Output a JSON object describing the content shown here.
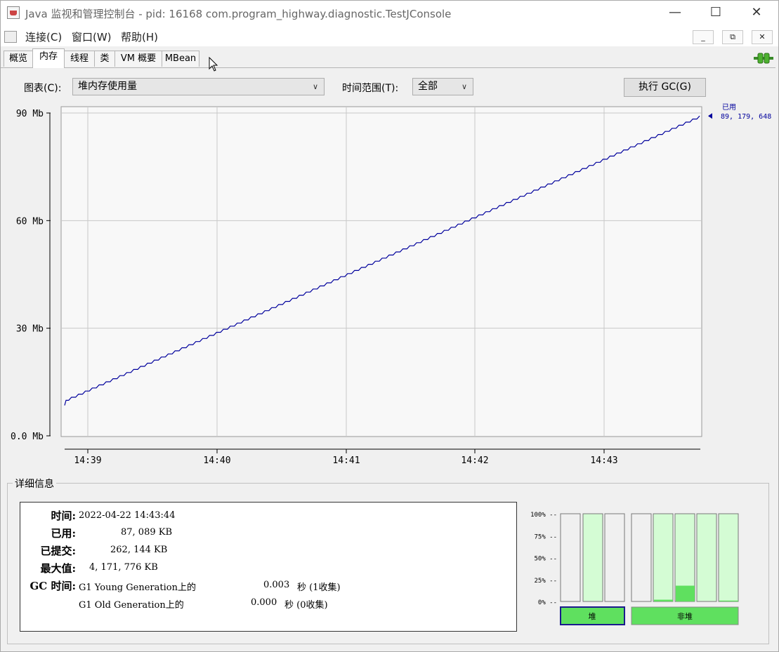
{
  "window": {
    "title": "Java 监视和管理控制台 - pid: 16168 com.program_highway.diagnostic.TestJConsole",
    "min_icon": "minimize-icon",
    "max_icon": "maximize-icon",
    "close_icon": "close-icon"
  },
  "menu": {
    "items": [
      "连接(C)",
      "窗口(W)",
      "帮助(H)"
    ],
    "mdi_buttons": [
      "_",
      "⧉",
      "✕"
    ]
  },
  "tabs": {
    "items": [
      "概览",
      "内存",
      "线程",
      "类",
      "VM 概要",
      "MBean"
    ],
    "active": "内存"
  },
  "controls": {
    "chart_label": "图表(C):",
    "chart_value": "堆内存使用量",
    "range_label": "时间范围(T):",
    "range_value": "全部",
    "gc_button": "执行 GC(G)"
  },
  "chart_data": {
    "type": "line",
    "y_ticks": [
      "90 Mb",
      "60 Mb",
      "30 Mb",
      "0.0 Mb"
    ],
    "y_tick_values": [
      90,
      60,
      30,
      0
    ],
    "x_ticks": [
      "14:39",
      "14:40",
      "14:41",
      "14:42",
      "14:43"
    ],
    "ylim": [
      0,
      90
    ],
    "series": [
      {
        "name": "已用",
        "color": "#00009c",
        "start_value_mb": 8.5,
        "end_value_mb": 89.18,
        "shape": "staircase-linear"
      }
    ],
    "legend": {
      "label": "已用",
      "value": "89, 179, 648"
    },
    "grid": true,
    "background": "#f8f8f8"
  },
  "details": {
    "title": "详细信息",
    "rows": [
      {
        "label": "时间:",
        "value": "2022-04-22 14:43:44"
      },
      {
        "label": "已用:",
        "value": "87, 089 KB"
      },
      {
        "label": "已提交:",
        "value": "262, 144 KB"
      },
      {
        "label": "最大值:",
        "value": "4, 171, 776 KB"
      }
    ],
    "gc_label": "GC 时间:",
    "gc_rows": [
      {
        "name": "G1 Young Generation上的",
        "time": "0.003",
        "unit": "秒 (1收集)"
      },
      {
        "name": "G1 Old Generation上的",
        "time": "0.000",
        "unit": "秒 (0收集)"
      }
    ]
  },
  "pools": {
    "y_labels": [
      "100% --",
      "75% --",
      "50% --",
      "25% --",
      "0% --"
    ],
    "heap_label": "堆",
    "nonheap_label": "非堆",
    "heap_bars": [
      {
        "capacity_pct": 100,
        "used_pct": 0,
        "filled_bg": false
      },
      {
        "capacity_pct": 100,
        "used_pct": 0,
        "filled_bg": true
      },
      {
        "capacity_pct": 100,
        "used_pct": 0,
        "filled_bg": false
      }
    ],
    "nonheap_bars": [
      {
        "capacity_pct": 100,
        "used_pct": 0,
        "filled_bg": false
      },
      {
        "capacity_pct": 100,
        "used_pct": 2,
        "filled_bg": true
      },
      {
        "capacity_pct": 100,
        "used_pct": 18,
        "filled_bg": true
      },
      {
        "capacity_pct": 100,
        "used_pct": 0,
        "filled_bg": true
      },
      {
        "capacity_pct": 100,
        "used_pct": 1,
        "filled_bg": true
      }
    ],
    "colors": {
      "used": "#5fe05f",
      "capacity": "#d4fcd4",
      "empty": "#f0f0f0",
      "heap_border": "#1a1a8c"
    }
  }
}
